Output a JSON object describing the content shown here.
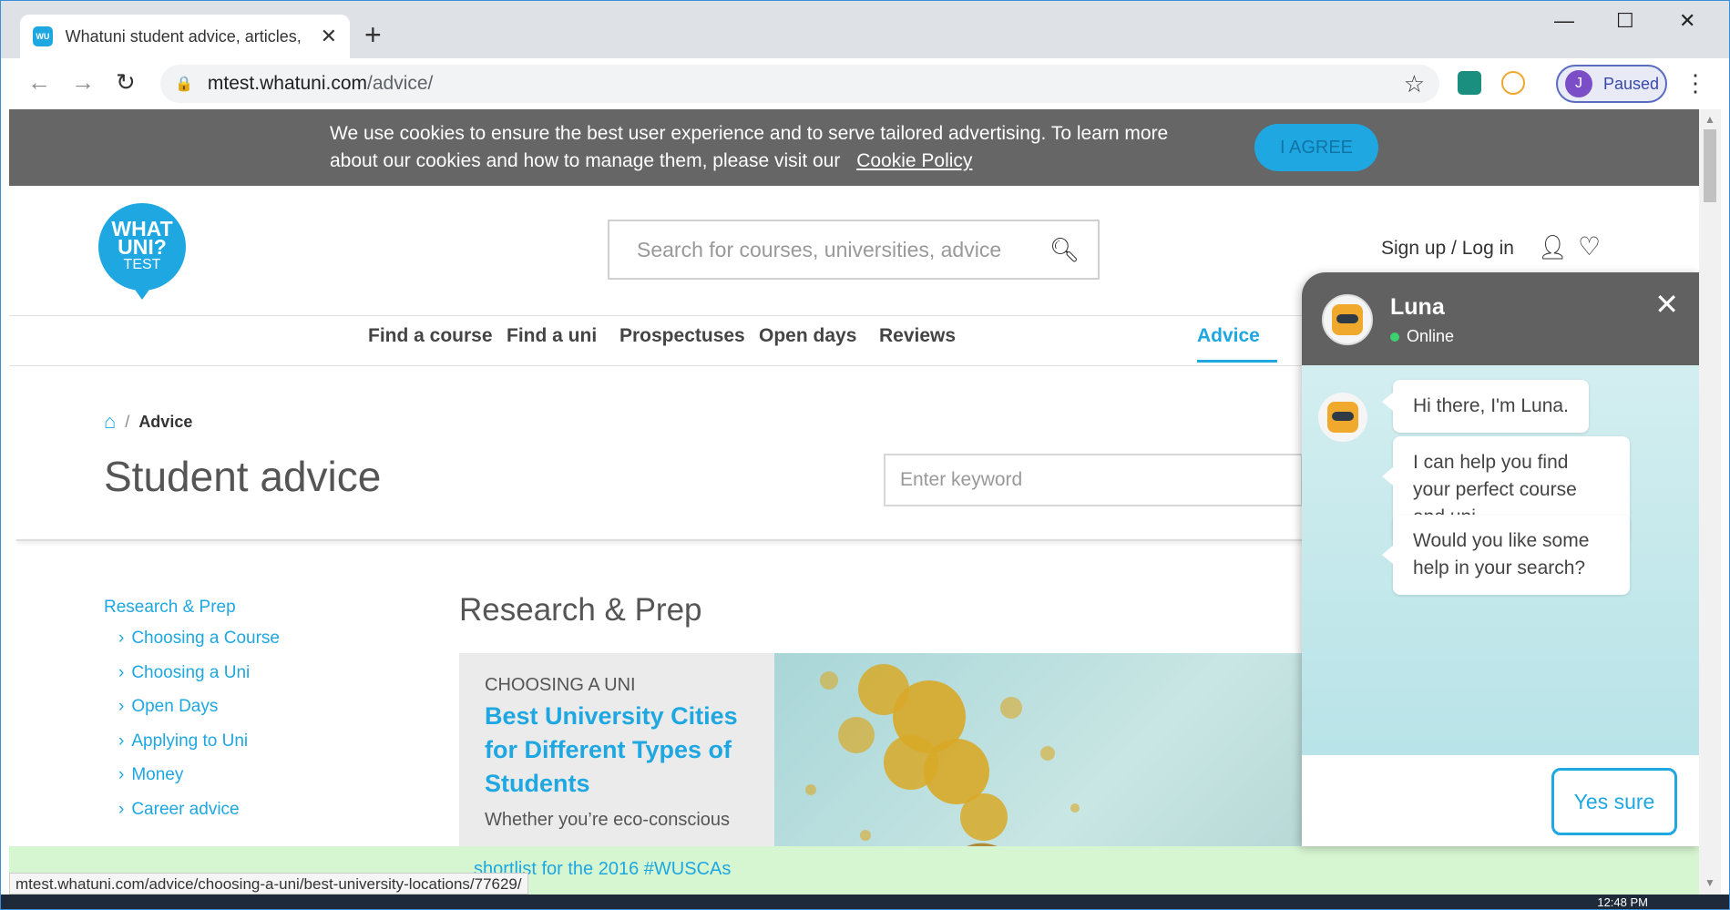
{
  "browser": {
    "tab_title": "Whatuni student advice, articles,",
    "tab_favicon": "WU",
    "new_tab_label": "+",
    "url_host": "mtest.whatuni.com",
    "url_path": "/advice/",
    "profile_initial": "J",
    "profile_label": "Paused"
  },
  "cookie": {
    "text": "We use cookies to ensure the best user experience and to serve tailored advertising. To learn more about our cookies and how to manage them, please visit our",
    "link": "Cookie Policy",
    "agree": "I AGREE"
  },
  "header": {
    "logo_line1": "WHAT",
    "logo_line2": "UNI?",
    "logo_line3": "TEST",
    "search_placeholder": "Search for courses, universities, advice",
    "signup": "Sign up / Log in"
  },
  "nav": {
    "items": [
      "Find a course",
      "Find a uni",
      "Prospectuses",
      "Open days",
      "Reviews",
      "Advice"
    ],
    "active": "Advice"
  },
  "page": {
    "breadcrumb_sep": "/",
    "breadcrumb_current": "Advice",
    "title": "Student advice",
    "keyword_placeholder": "Enter keyword"
  },
  "sidebar": {
    "heading": "Research & Prep",
    "items": [
      "Choosing a Course",
      "Choosing a Uni",
      "Open Days",
      "Applying to Uni",
      "Money",
      "Career advice"
    ]
  },
  "main": {
    "section_title": "Research & Prep",
    "card": {
      "category": "CHOOSING A UNI",
      "title": "Best University Cities for Different Types of Students",
      "snippet": "Whether you’re eco-conscious"
    }
  },
  "announcement": {
    "text": "shortlist for the 2016 #WUSCAs"
  },
  "status_url": "mtest.whatuni.com/advice/choosing-a-uni/best-university-locations/77629/",
  "chat": {
    "name": "Luna",
    "status": "Online",
    "messages": [
      "Hi there, I'm Luna.",
      "I can help you find your perfect course and uni.",
      "Would you like some help in your search?"
    ],
    "reply_button": "Yes sure"
  },
  "taskbar": {
    "clock": "12:48 PM"
  },
  "colors": {
    "brand": "#1ea7e1",
    "cookie_bg": "#666666",
    "chat_header": "#616161",
    "online": "#3bd16f",
    "announce_bg": "#d6f5d1"
  }
}
